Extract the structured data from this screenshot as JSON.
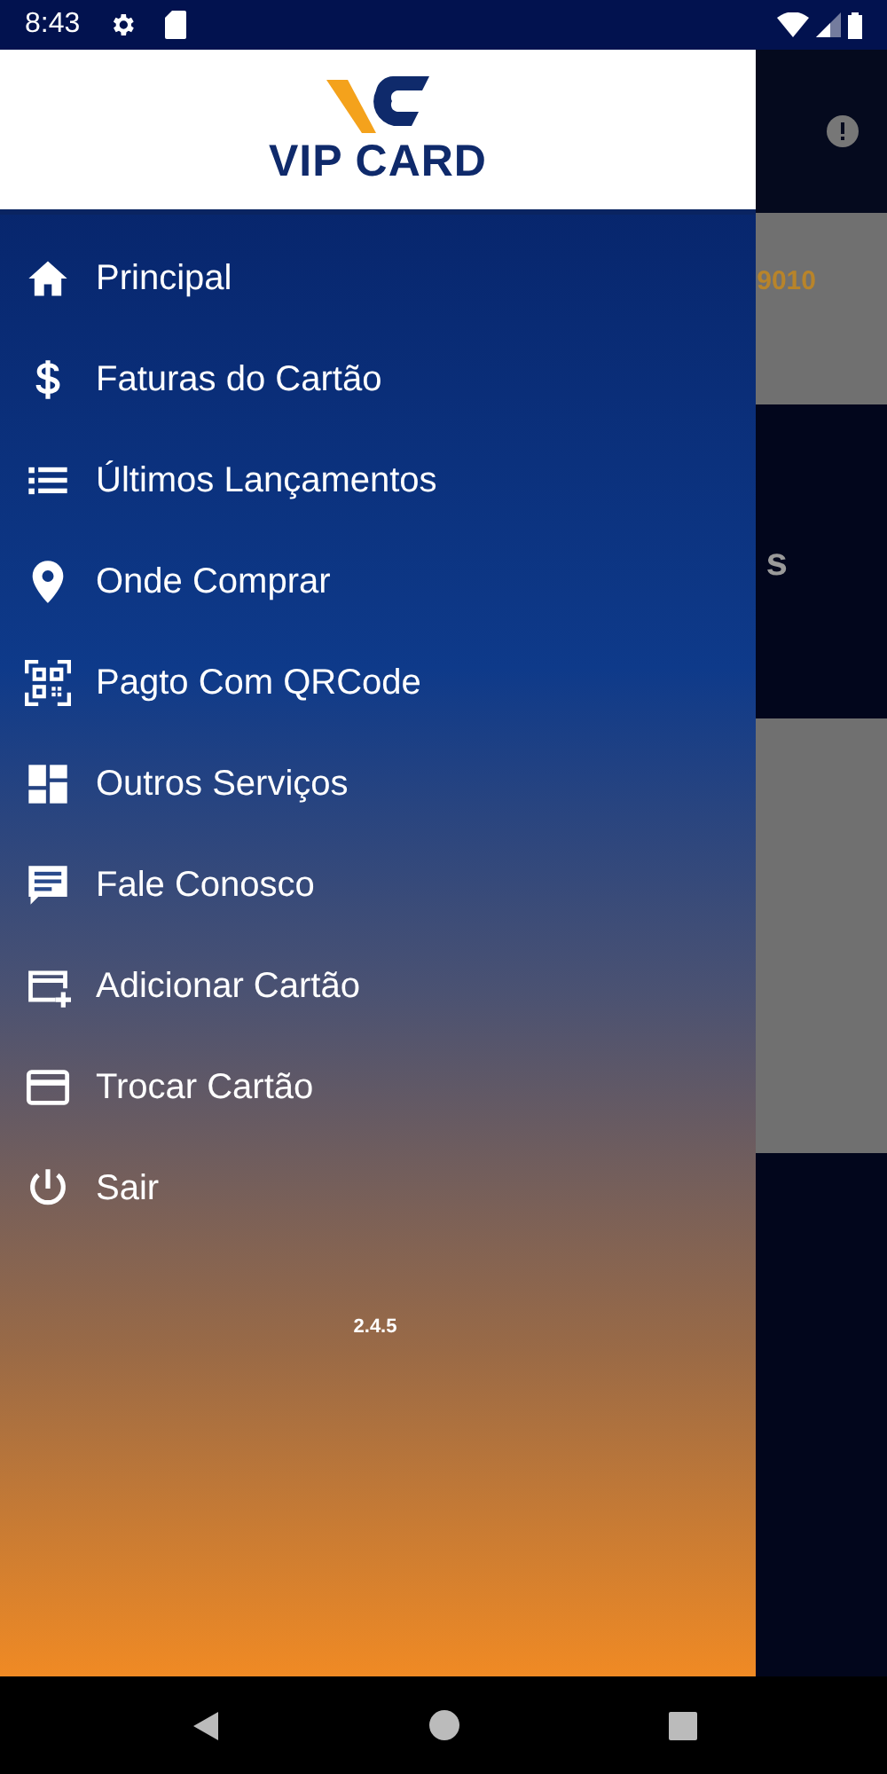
{
  "status_bar": {
    "time": "8:43"
  },
  "drawer": {
    "logo_text": "VIP CARD",
    "items": [
      {
        "label": "Principal",
        "kind": "home"
      },
      {
        "label": "Faturas do Cartão",
        "kind": "dollar"
      },
      {
        "label": "Últimos Lançamentos",
        "kind": "list"
      },
      {
        "label": "Onde Comprar",
        "kind": "pin"
      },
      {
        "label": "Pagto Com QRCode",
        "kind": "qr"
      },
      {
        "label": "Outros Serviços",
        "kind": "dashboard"
      },
      {
        "label": "Fale Conosco",
        "kind": "chat"
      },
      {
        "label": "Adicionar Cartão",
        "kind": "addcard"
      },
      {
        "label": "Trocar Cartão",
        "kind": "card"
      },
      {
        "label": "Sair",
        "kind": "power"
      }
    ],
    "version": "2.4.5"
  },
  "background": {
    "card_number": "9010",
    "heading": "s"
  }
}
